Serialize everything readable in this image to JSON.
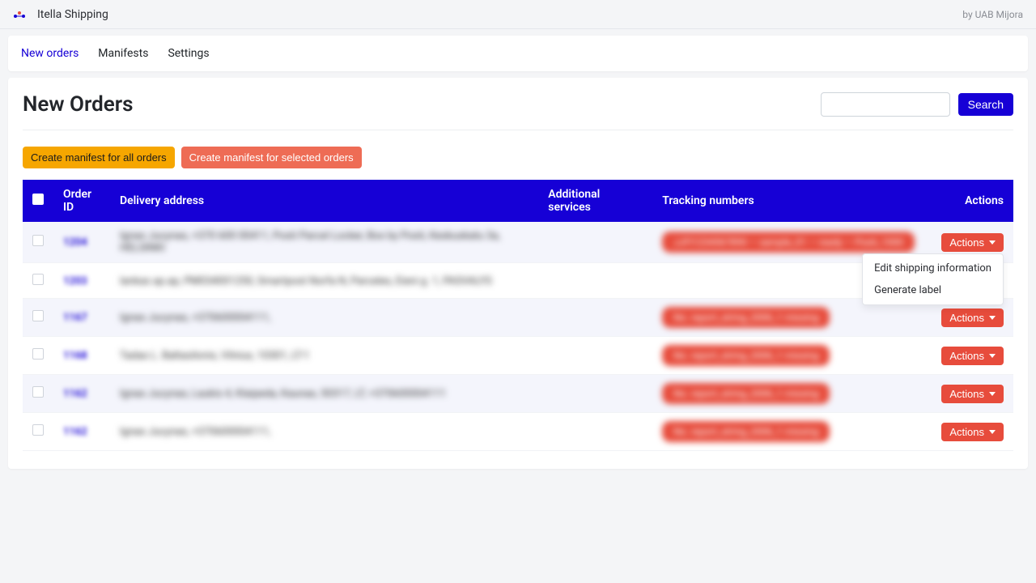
{
  "topbar": {
    "title": "Itella Shipping",
    "byline": "by UAB Mijora"
  },
  "tabs": {
    "new_orders": "New orders",
    "manifests": "Manifests",
    "settings": "Settings"
  },
  "page": {
    "title": "New Orders",
    "search_button": "Search",
    "search_value": ""
  },
  "manifest_buttons": {
    "all": "Create manifest for all orders",
    "selected": "Create manifest for selected orders"
  },
  "columns": {
    "order_id": "Order ID",
    "delivery_address": "Delivery address",
    "additional_services": "Additional services",
    "tracking_numbers": "Tracking numbers",
    "actions": "Actions"
  },
  "actions_label": "Actions",
  "dropdown": {
    "edit_shipping": "Edit shipping information",
    "generate_label": "Generate label"
  },
  "rows": [
    {
      "id": "1204",
      "address": "Ignas Jucynas, +370 600 00411, Posti Parcel Locker, Box by Posti, Keskuskatu 3a, HELSINKI",
      "tracking": "JJFI1234567890 — sample_01 — ready — Posti_1000",
      "tracking_wide": true,
      "has_tracking": true
    },
    {
      "id": "1203",
      "address": "lankas ap.ap, PM034001250, Smartpost Norfa N, Parceles, Eieni g. 1, PASVALYS",
      "tracking": "",
      "has_tracking": false
    },
    {
      "id": "1167",
      "address": "Ignas Jucynas, +370600004111,",
      "tracking": "No. report_string_2006_1 missing",
      "has_tracking": true
    },
    {
      "id": "1168",
      "address": "Tadas L. Baltasilonis, Vilnius, 10301, LT-1",
      "tracking": "No. report_string_2006_1 missing",
      "has_tracking": true
    },
    {
      "id": "1162",
      "address": "Ignas Jucynas, Laukis 4, Klaipeda, Kaunas, 50317, LT, +370600004111",
      "tracking": "No. report_string_2006_1 missing",
      "has_tracking": true
    },
    {
      "id": "1162",
      "address": "Ignas Jucynas, +370600004111,",
      "tracking": "No. report_string_2006_1 missing",
      "has_tracking": true
    }
  ]
}
